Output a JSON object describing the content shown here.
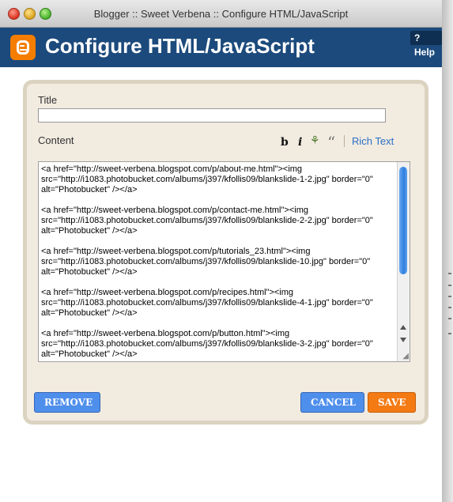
{
  "window": {
    "title": "Blogger :: Sweet Verbena :: Configure HTML/JavaScript"
  },
  "header": {
    "title": "Configure HTML/JavaScript",
    "help_label": "? Help"
  },
  "form": {
    "title_label": "Title",
    "title_value": "",
    "content_label": "Content",
    "toolbar": {
      "bold": "b",
      "italic": "i",
      "link": "⚘",
      "quote": "“",
      "rich_text": "Rich Text"
    },
    "content_text": "<a href=\"http://sweet-verbena.blogspot.com/p/about-me.html\"><img src=\"http://i1083.photobucket.com/albums/j397/kfollis09/blankslide-1-2.jpg\" border=\"0\" alt=\"Photobucket\" /></a>\n\n<a href=\"http://sweet-verbena.blogspot.com/p/contact-me.html\"><img src=\"http://i1083.photobucket.com/albums/j397/kfollis09/blankslide-2-2.jpg\" border=\"0\" alt=\"Photobucket\" /></a>\n\n<a href=\"http://sweet-verbena.blogspot.com/p/tutorials_23.html\"><img src=\"http://i1083.photobucket.com/albums/j397/kfollis09/blankslide-10.jpg\" border=\"0\" alt=\"Photobucket\" /></a>\n\n<a href=\"http://sweet-verbena.blogspot.com/p/recipes.html\"><img src=\"http://i1083.photobucket.com/albums/j397/kfollis09/blankslide-4-1.jpg\" border=\"0\" alt=\"Photobucket\" /></a>\n\n<a href=\"http://sweet-verbena.blogspot.com/p/button.html\"><img src=\"http://i1083.photobucket.com/albums/j397/kfollis09/blankslide-3-2.jpg\" border=\"0\" alt=\"Photobucket\" /></a>"
  },
  "buttons": {
    "remove": "REMOVE",
    "cancel": "CANCEL",
    "save": "SAVE"
  },
  "colors": {
    "header_bg": "#1c4a7c",
    "blue_button": "#4f8fec",
    "save_button": "#f47a13",
    "link": "#2a6fc5"
  }
}
